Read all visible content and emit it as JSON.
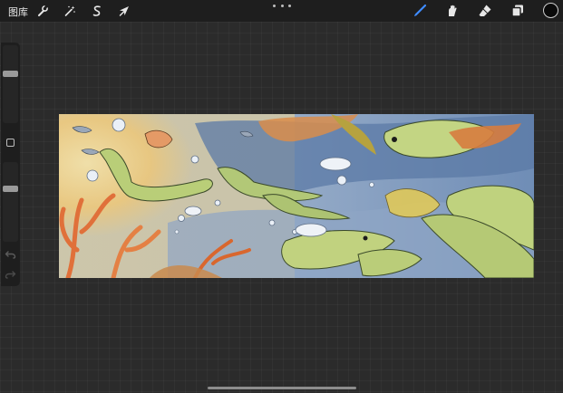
{
  "toolbar": {
    "gallery_label": "图库",
    "left_tools": [
      {
        "icon": "wrench-icon",
        "name": "actions"
      },
      {
        "icon": "magic-wand-icon",
        "name": "adjustments"
      },
      {
        "icon": "selection-icon",
        "name": "selection"
      },
      {
        "icon": "arrow-cursor-icon",
        "name": "transform"
      }
    ],
    "right_tools": [
      {
        "icon": "brush-icon",
        "name": "brush",
        "active": true
      },
      {
        "icon": "smudge-icon",
        "name": "smudge",
        "active": false
      },
      {
        "icon": "eraser-icon",
        "name": "eraser",
        "active": false
      },
      {
        "icon": "layers-icon",
        "name": "layers",
        "active": false
      }
    ],
    "accent_color": "#3f8cff",
    "current_color": "#0a0a0a"
  },
  "sidebar": {
    "brush_size": 0.36,
    "opacity": 0.32,
    "icons": [
      "modify-square-icon",
      "undo-icon",
      "redo-icon"
    ]
  },
  "artwork": {
    "theme": "underwater",
    "colors": {
      "sand": "#f2d58a",
      "water": "#9fb4cf",
      "deep_water": "#5a79a3",
      "fish": "#b8cf75",
      "coral": "#e07a3a",
      "plant": "#b6a23f"
    }
  }
}
